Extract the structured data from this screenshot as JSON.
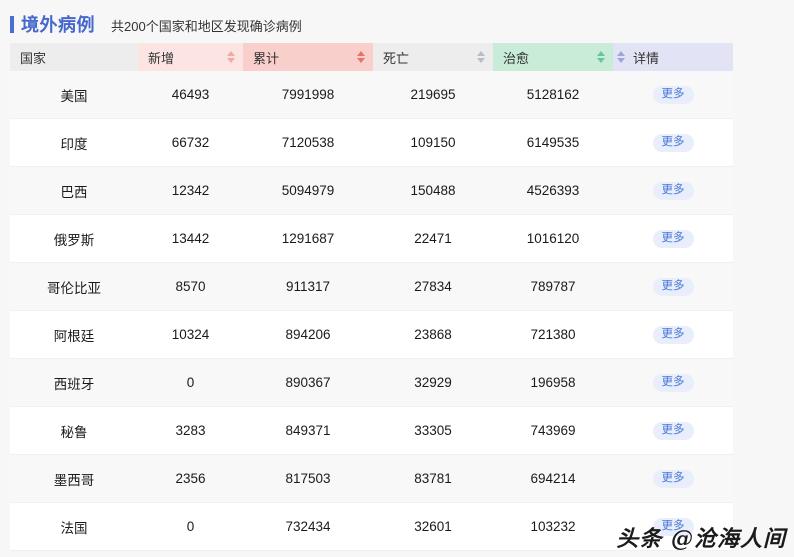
{
  "header": {
    "title": "境外病例",
    "subtitle": "共200个国家和地区发现确诊病例",
    "accent_color": "#4a6ecb"
  },
  "table": {
    "columns": [
      {
        "key": "country",
        "label": "国家",
        "bg": "#ededee",
        "sortable": false,
        "sort_state": "none"
      },
      {
        "key": "new",
        "label": "新增",
        "bg": "#fbe4e2",
        "sortable": true,
        "sort_state": "none"
      },
      {
        "key": "total",
        "label": "累计",
        "bg": "#f9cfcb",
        "sortable": true,
        "sort_state": "active"
      },
      {
        "key": "death",
        "label": "死亡",
        "bg": "#ededee",
        "sortable": true,
        "sort_state": "none"
      },
      {
        "key": "cured",
        "label": "治愈",
        "bg": "#c9ecd9",
        "sortable": true,
        "sort_state": "none"
      },
      {
        "key": "detail",
        "label": "详情",
        "bg": "#e2e3f5",
        "sortable": true,
        "sort_state": "none"
      }
    ],
    "detail_button_label": "更多",
    "rows": [
      {
        "country": "美国",
        "new": "46493",
        "total": "7991998",
        "death": "219695",
        "cured": "5128162"
      },
      {
        "country": "印度",
        "new": "66732",
        "total": "7120538",
        "death": "109150",
        "cured": "6149535"
      },
      {
        "country": "巴西",
        "new": "12342",
        "total": "5094979",
        "death": "150488",
        "cured": "4526393"
      },
      {
        "country": "俄罗斯",
        "new": "13442",
        "total": "1291687",
        "death": "22471",
        "cured": "1016120"
      },
      {
        "country": "哥伦比亚",
        "new": "8570",
        "total": "911317",
        "death": "27834",
        "cured": "789787"
      },
      {
        "country": "阿根廷",
        "new": "10324",
        "total": "894206",
        "death": "23868",
        "cured": "721380"
      },
      {
        "country": "西班牙",
        "new": "0",
        "total": "890367",
        "death": "32929",
        "cured": "196958"
      },
      {
        "country": "秘鲁",
        "new": "3283",
        "total": "849371",
        "death": "33305",
        "cured": "743969"
      },
      {
        "country": "墨西哥",
        "new": "2356",
        "total": "817503",
        "death": "83781",
        "cured": "694214"
      },
      {
        "country": "法国",
        "new": "0",
        "total": "732434",
        "death": "32601",
        "cured": "103232"
      }
    ]
  },
  "watermark": {
    "text": "头条 @沧海人间"
  }
}
